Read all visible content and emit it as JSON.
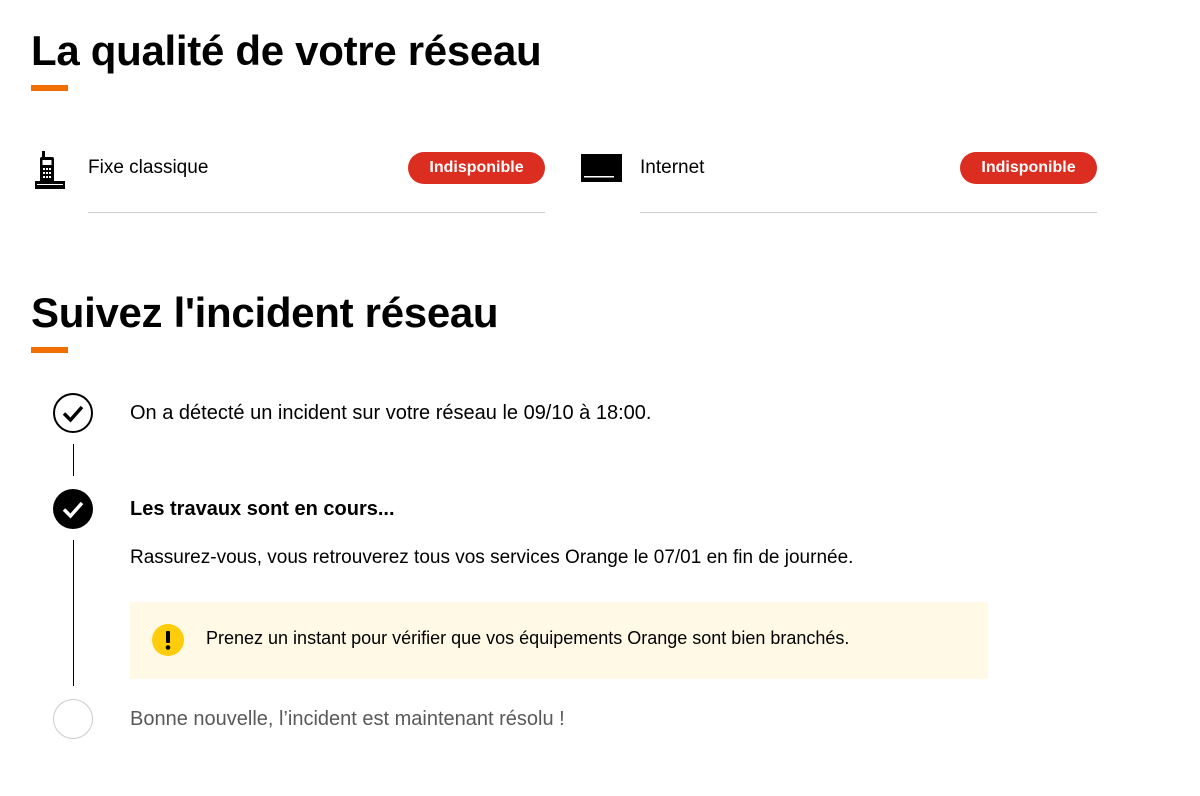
{
  "network_quality": {
    "title": "La qualité de votre réseau",
    "services": [
      {
        "label": "Fixe classique",
        "status": "Indisponible",
        "icon": "landline-phone-icon"
      },
      {
        "label": "Internet",
        "status": "Indisponible",
        "icon": "livebox-router-icon"
      }
    ]
  },
  "incident": {
    "title": "Suivez l'incident réseau",
    "steps": [
      {
        "text": "On a détecté un incident sur votre réseau le 09/10 à 18:00.",
        "state": "done",
        "icon": "check-circle-outline-icon"
      },
      {
        "title": "Les travaux sont en cours...",
        "text": "Rassurez-vous, vous retrouverez tous vos services Orange le 07/01 en fin de journée.",
        "state": "current",
        "icon": "check-circle-filled-icon"
      },
      {
        "text": "Bonne nouvelle, l’incident est maintenant résolu !",
        "state": "pending",
        "icon": "empty-circle-icon"
      }
    ],
    "notice": {
      "text": "Prenez un instant pour vérifier que vos équipements Orange sont bien branchés.",
      "icon": "warning-exclamation-icon"
    }
  },
  "colors": {
    "accent": "#f16e00",
    "status_unavailable": "#db2e20",
    "notice_background": "#fff9e6",
    "notice_icon": "#ffcd0b",
    "pending_text": "#595959"
  }
}
